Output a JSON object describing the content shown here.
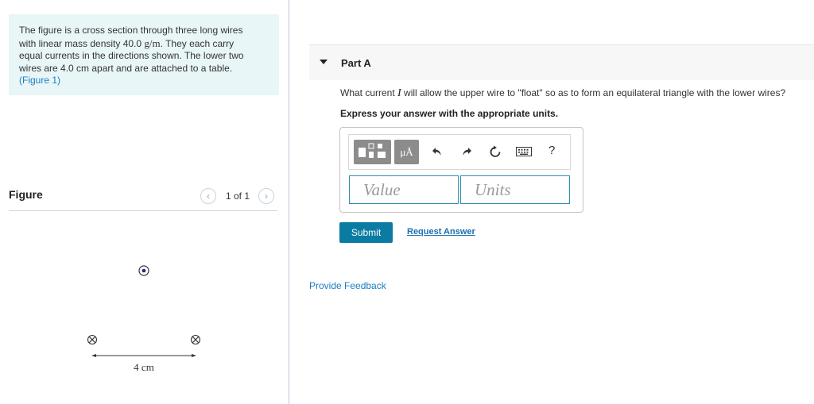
{
  "problem": {
    "text_line1": "The figure is a cross section through three long wires",
    "text_line2a": "with linear mass density 40.0 ",
    "text_unit": "g/m",
    "text_line2b": ". They each carry",
    "text_line3": "equal currents in the directions shown. The lower two",
    "text_line4": "wires are 4.0 cm apart and are attached to a table.",
    "figure_link": "(Figure 1)"
  },
  "figure": {
    "title": "Figure",
    "pager_text": "1 of 1",
    "prev_icon": "chevron-left-icon",
    "next_icon": "chevron-right-icon",
    "distance_label": "4 cm",
    "upper_wire": "current-out-of-page",
    "lower_wires": "current-into-page"
  },
  "part": {
    "label": "Part A",
    "question_a": "What current ",
    "question_var": "I",
    "question_b": " will allow the upper wire to \"float\" so as to form an equilateral triangle with the lower wires?",
    "instruction": "Express your answer with the appropriate units."
  },
  "toolbar": {
    "units_button": "μÅ",
    "icons": [
      "templates-icon",
      "units-icon",
      "undo-icon",
      "redo-icon",
      "reset-icon",
      "keyboard-icon",
      "help-icon"
    ],
    "help_symbol": "?"
  },
  "answer": {
    "value_placeholder": "Value",
    "units_placeholder": "Units"
  },
  "actions": {
    "submit": "Submit",
    "request_answer": "Request Answer",
    "feedback": "Provide Feedback"
  },
  "colors": {
    "problem_bg": "#e9f6f7",
    "accent": "#0a7ca3",
    "link": "#1a7dbf",
    "field_border": "#2e8fb0"
  }
}
